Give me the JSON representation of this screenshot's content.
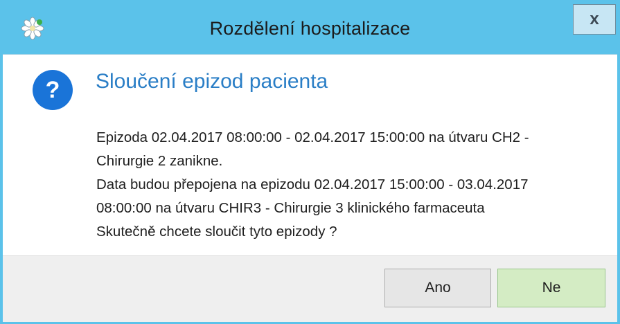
{
  "window": {
    "title": "Rozdělení hospitalizace",
    "close_label": "x"
  },
  "dialog": {
    "icon_glyph": "?",
    "heading": "Sloučení epizod pacienta",
    "message_lines": [
      "Epizoda 02.04.2017 08:00:00 - 02.04.2017 15:00:00 na útvaru CH2 -",
      "Chirurgie 2 zanikne.",
      "Data budou přepojena na epizodu 02.04.2017 15:00:00 - 03.04.2017",
      "08:00:00 na útvaru CHIR3 - Chirurgie 3 klinického farmaceuta",
      "Skutečně chcete sloučit tyto epizody ?"
    ]
  },
  "buttons": {
    "yes_label": "Ano",
    "no_label": "Ne"
  },
  "colors": {
    "titlebar": "#5bc2ea",
    "heading": "#2a7ec6",
    "question_icon": "#1a74d8",
    "default_button": "#d4ecc4"
  }
}
